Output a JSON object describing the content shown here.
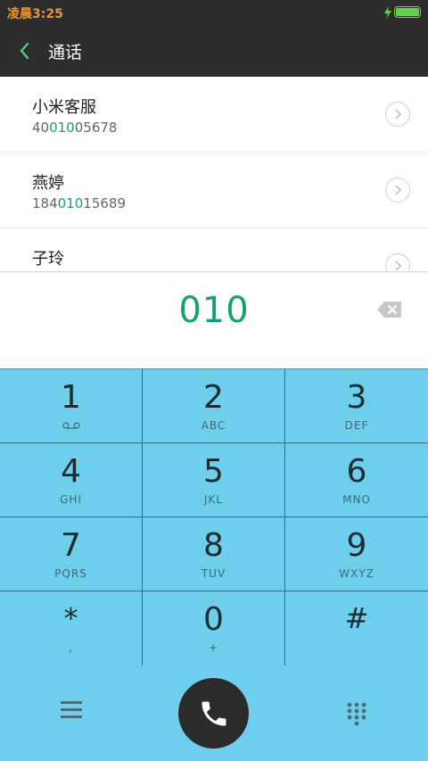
{
  "status_bar": {
    "time": "凌晨3:25",
    "battery_color": "#5ed44a"
  },
  "header": {
    "title": "通话"
  },
  "contacts": [
    {
      "name": "小米客服",
      "number_prefix": "40",
      "number_match": "010",
      "number_suffix": "05678"
    },
    {
      "name": "燕婷",
      "number_prefix": "184",
      "number_match": "010",
      "number_suffix": "15689"
    },
    {
      "name": "子玲",
      "number_prefix": "",
      "number_match": "",
      "number_suffix": ""
    }
  ],
  "dial": {
    "number": "010",
    "accent": "#1aa06a"
  },
  "keypad": {
    "k1": {
      "digit": "1",
      "letters": ""
    },
    "k2": {
      "digit": "2",
      "letters": "ABC"
    },
    "k3": {
      "digit": "3",
      "letters": "DEF"
    },
    "k4": {
      "digit": "4",
      "letters": "GHI"
    },
    "k5": {
      "digit": "5",
      "letters": "JKL"
    },
    "k6": {
      "digit": "6",
      "letters": "MNO"
    },
    "k7": {
      "digit": "7",
      "letters": "PQRS"
    },
    "k8": {
      "digit": "8",
      "letters": "TUV"
    },
    "k9": {
      "digit": "9",
      "letters": "WXYZ"
    },
    "kstar": {
      "digit": "*",
      "letters": ","
    },
    "k0": {
      "digit": "0",
      "letters": "+"
    },
    "khash": {
      "digit": "#",
      "letters": ""
    }
  },
  "icons": {
    "back": "back-arrow-icon",
    "detail": "chevron-right-icon",
    "backspace": "backspace-icon",
    "voicemail": "voicemail-icon",
    "menu": "menu-icon",
    "call": "phone-icon",
    "dialpad": "dialpad-icon"
  },
  "colors": {
    "keypad_bg": "#6ecfec",
    "header_bg": "#2d2d2d",
    "call_button": "#2b2b2b"
  }
}
